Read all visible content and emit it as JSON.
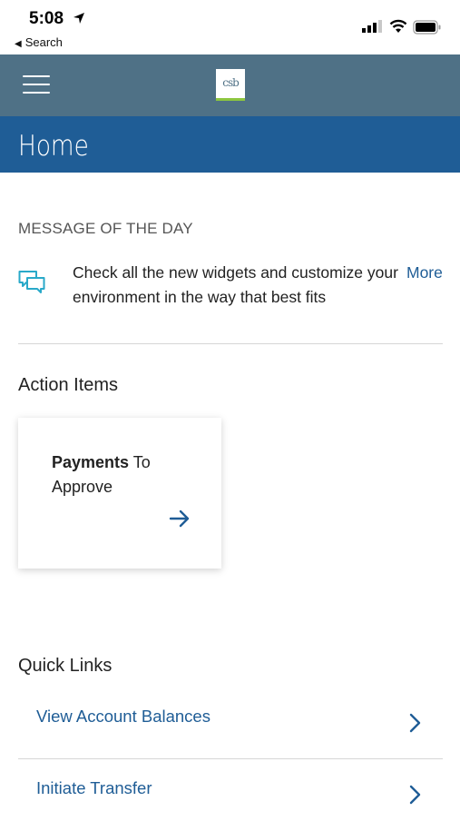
{
  "status_bar": {
    "time": "5:08",
    "back_label": "Search"
  },
  "header": {
    "logo_text": "csb",
    "title": "Home"
  },
  "message_of_the_day": {
    "heading": "MESSAGE OF THE DAY",
    "text": "Check all the new widgets and customize your environment in the way that best fits",
    "more_label": "More"
  },
  "action_items": {
    "heading": "Action Items",
    "card": {
      "bold_text": "Payments",
      "rest_text": " To Approve"
    }
  },
  "quick_links": {
    "heading": "Quick Links",
    "items": [
      {
        "label": "View Account Balances"
      },
      {
        "label": "Initiate Transfer"
      }
    ]
  },
  "colors": {
    "header_bg": "#4f7186",
    "title_bar_bg": "#1f5d96",
    "link": "#1f5d96",
    "accent_green": "#8dc63f"
  }
}
